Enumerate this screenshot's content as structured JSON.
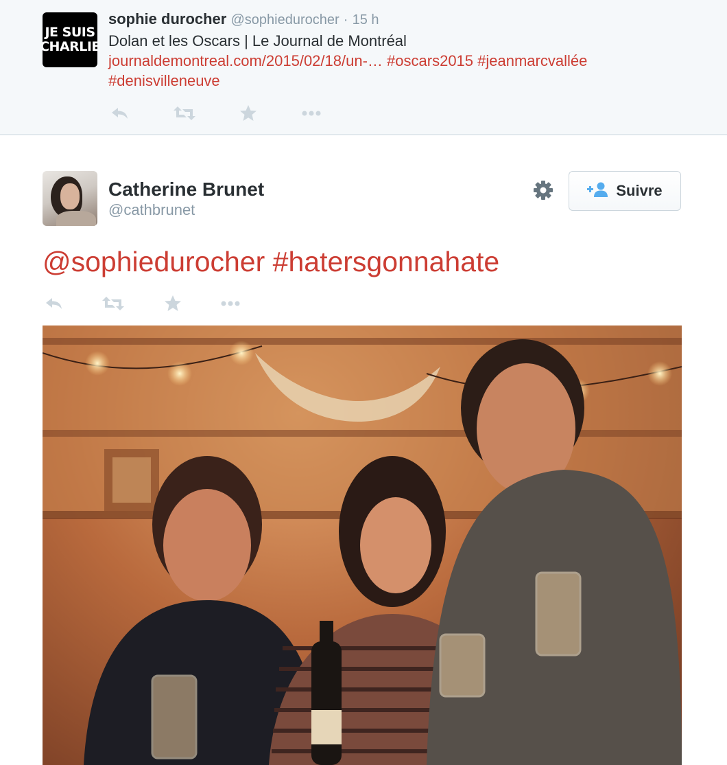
{
  "parent_tweet": {
    "avatar_text": [
      "JE SUIS",
      "CHARLIE"
    ],
    "name": "sophie durocher",
    "handle": "@sophiedurocher",
    "separator": "·",
    "time": "15 h",
    "text_line1": "Dolan et les Oscars | Le Journal de Montréal",
    "link": "journaldemontreal.com/2015/02/18/un-…",
    "hashtags": [
      "#oscars2015",
      "#jeanmarcvallée",
      "#denisvilleneuve"
    ],
    "actions": [
      {
        "icon": "reply-icon"
      },
      {
        "icon": "retweet-icon"
      },
      {
        "icon": "favorite-star-icon"
      },
      {
        "icon": "more-dots-icon"
      }
    ]
  },
  "main_tweet": {
    "name": "Catherine Brunet",
    "handle": "@cathbrunet",
    "follow_label": "Suivre",
    "mention": "@sophiedurocher",
    "hashtag": "#hatersgonnahate",
    "actions": [
      {
        "icon": "reply-icon"
      },
      {
        "icon": "retweet-icon"
      },
      {
        "icon": "favorite-star-icon"
      },
      {
        "icon": "more-dots-icon"
      }
    ]
  },
  "colors": {
    "link": "#cc3d33",
    "meta": "#8899a6",
    "action": "#ccd6dd",
    "follow_icon": "#55acee",
    "text": "#292f33",
    "parent_bg": "#f5f8fa"
  }
}
